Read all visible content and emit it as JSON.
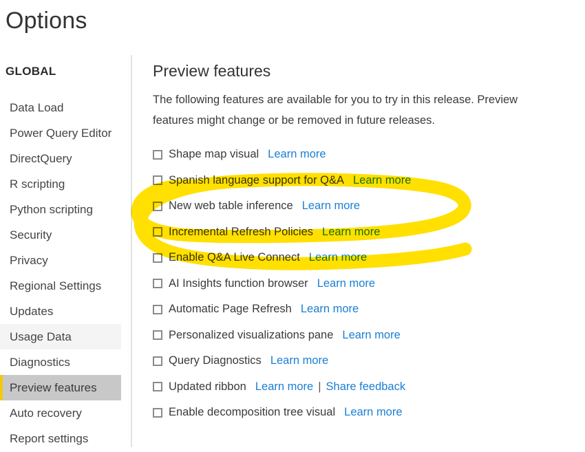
{
  "window": {
    "title": "Options"
  },
  "sidebar": {
    "heading": "GLOBAL",
    "items": [
      {
        "label": "Data Load",
        "state": "normal"
      },
      {
        "label": "Power Query Editor",
        "state": "normal"
      },
      {
        "label": "DirectQuery",
        "state": "normal"
      },
      {
        "label": "R scripting",
        "state": "normal"
      },
      {
        "label": "Python scripting",
        "state": "normal"
      },
      {
        "label": "Security",
        "state": "normal"
      },
      {
        "label": "Privacy",
        "state": "normal"
      },
      {
        "label": "Regional Settings",
        "state": "normal"
      },
      {
        "label": "Updates",
        "state": "normal"
      },
      {
        "label": "Usage Data",
        "state": "hover"
      },
      {
        "label": "Diagnostics",
        "state": "normal"
      },
      {
        "label": "Preview features",
        "state": "selected"
      },
      {
        "label": "Auto recovery",
        "state": "normal"
      },
      {
        "label": "Report settings",
        "state": "normal"
      }
    ]
  },
  "main": {
    "section_title": "Preview features",
    "description": "The following features are available for you to try in this release. Preview features might change or be removed in future releases.",
    "features": [
      {
        "label": "Shape map visual",
        "checked": false,
        "links": [
          "Learn more"
        ]
      },
      {
        "label": "Spanish language support for Q&A",
        "checked": false,
        "links": [
          "Learn more"
        ]
      },
      {
        "label": "New web table inference",
        "checked": false,
        "links": [
          "Learn more"
        ]
      },
      {
        "label": "Incremental Refresh Policies",
        "checked": false,
        "links": [
          "Learn more"
        ]
      },
      {
        "label": "Enable Q&A Live Connect",
        "checked": false,
        "links": [
          "Learn more"
        ]
      },
      {
        "label": "AI Insights function browser",
        "checked": false,
        "links": [
          "Learn more"
        ]
      },
      {
        "label": "Automatic Page Refresh",
        "checked": false,
        "links": [
          "Learn more"
        ]
      },
      {
        "label": "Personalized visualizations pane",
        "checked": false,
        "links": [
          "Learn more"
        ]
      },
      {
        "label": "Query Diagnostics",
        "checked": false,
        "links": [
          "Learn more"
        ]
      },
      {
        "label": "Updated ribbon",
        "checked": false,
        "links": [
          "Learn more",
          "Share feedback"
        ]
      },
      {
        "label": "Enable decomposition tree visual",
        "checked": false,
        "links": [
          "Learn more"
        ]
      }
    ],
    "link_separator": "|"
  },
  "annotation": {
    "type": "highlighter-oval",
    "color": "#ffe000",
    "encircles": [
      "Shape map visual",
      "Spanish language support for Q&A",
      "New web table inference"
    ]
  },
  "colors": {
    "accent_gold": "#f2c811",
    "link_blue": "#1a7fd4",
    "selected_row": "#c8c8c8",
    "hover_row": "#f4f4f4",
    "highlighter": "#ffe000",
    "divider": "#e2e2e2"
  }
}
